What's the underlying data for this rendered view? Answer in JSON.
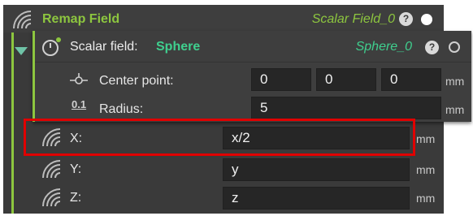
{
  "header": {
    "title": "Remap Field",
    "type_label": "Scalar Field_0",
    "help_label": "?",
    "field_icon": "field-wave-icon",
    "accent": "#8dc63f"
  },
  "subpanel": {
    "label": "Scalar field:",
    "type": "Sphere",
    "name": "Sphere_0",
    "help_label": "?",
    "icon": "sphere-circle-icon",
    "accent": "#3fcf8e",
    "rows": {
      "center": {
        "label": "Center point:",
        "icon": "center-point-icon",
        "values": [
          "0",
          "0",
          "0"
        ],
        "unit": "mm"
      },
      "radius": {
        "label": "Radius:",
        "icon": "decimal-value-icon",
        "icon_text": "0.1",
        "value": "5",
        "unit": "mm"
      }
    }
  },
  "remap_rows": {
    "x": {
      "label": "X:",
      "value": "x/2",
      "unit": "mm",
      "icon": "field-wave-icon"
    },
    "y": {
      "label": "Y:",
      "value": "y",
      "unit": "mm",
      "icon": "field-wave-icon"
    },
    "z": {
      "label": "Z:",
      "value": "z",
      "unit": "mm",
      "icon": "field-wave-icon"
    }
  },
  "highlight_color": "#e00000"
}
